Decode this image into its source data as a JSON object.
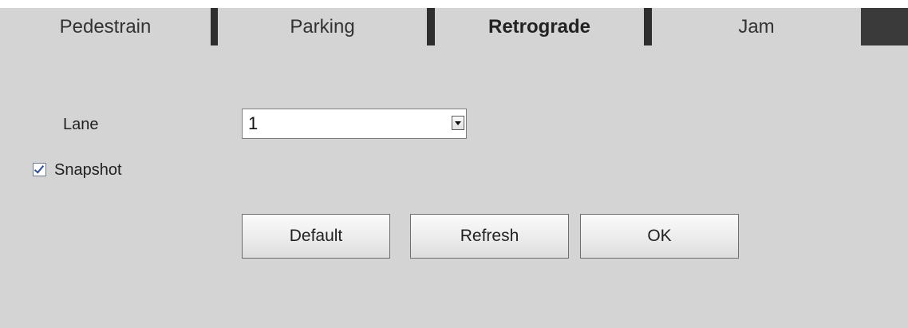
{
  "tabs": [
    {
      "label": "Pedestrain",
      "active": false
    },
    {
      "label": "Parking",
      "active": false
    },
    {
      "label": "Retrograde",
      "active": true
    },
    {
      "label": "Jam",
      "active": false
    }
  ],
  "form": {
    "lane_label": "Lane",
    "lane_value": "1",
    "snapshot_label": "Snapshot",
    "snapshot_checked": true
  },
  "buttons": {
    "default_label": "Default",
    "refresh_label": "Refresh",
    "ok_label": "OK"
  },
  "colors": {
    "panel_background": "#d4d4d4",
    "tab_separator": "#2e2e2e",
    "check_mark": "#2a4b9c"
  },
  "icons": {
    "dropdown": "chevron-down-icon",
    "checkbox": "checkmark-icon"
  }
}
